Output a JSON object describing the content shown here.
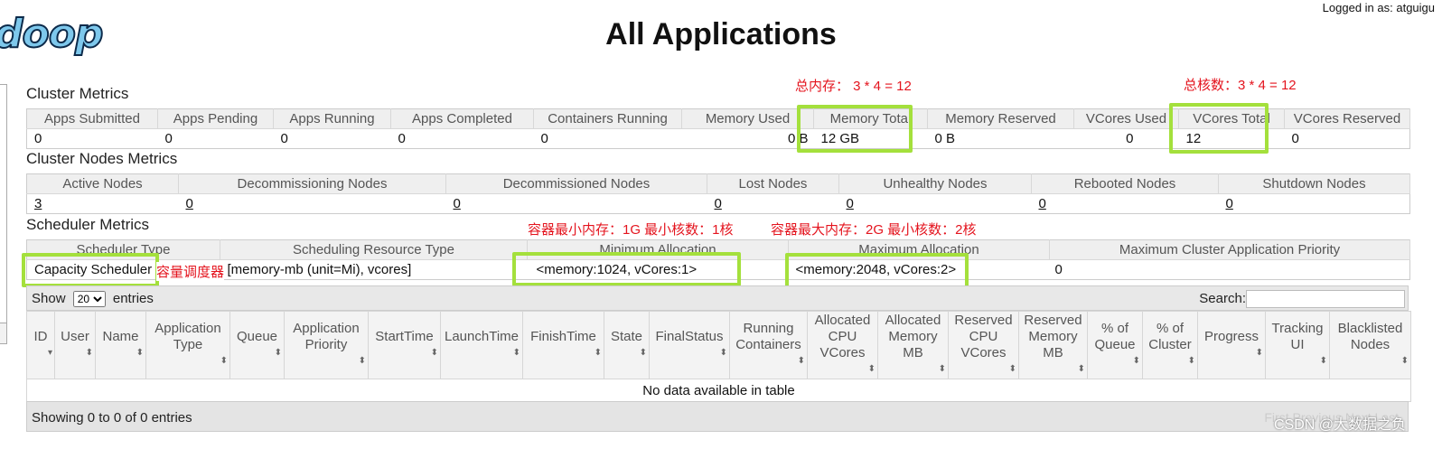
{
  "header": {
    "logo_text": "doop",
    "title": "All Applications",
    "logged_in": "Logged in as: atguigu"
  },
  "cluster_metrics": {
    "title": "Cluster Metrics",
    "headers": [
      "Apps Submitted",
      "Apps Pending",
      "Apps Running",
      "Apps Completed",
      "Containers Running",
      "Memory Used",
      "Memory Total",
      "Memory Reserved",
      "VCores Used",
      "VCores Total",
      "VCores Reserved"
    ],
    "values": [
      "0",
      "0",
      "0",
      "0",
      "0",
      "0 B",
      "12 GB",
      "0 B",
      "0",
      "12",
      "0"
    ]
  },
  "nodes_metrics": {
    "title": "Cluster Nodes Metrics",
    "headers": [
      "Active Nodes",
      "Decommissioning Nodes",
      "Decommissioned Nodes",
      "Lost Nodes",
      "Unhealthy Nodes",
      "Rebooted Nodes",
      "Shutdown Nodes"
    ],
    "values": [
      "3",
      "0",
      "0",
      "0",
      "0",
      "0",
      "0"
    ]
  },
  "scheduler_metrics": {
    "title": "Scheduler Metrics",
    "headers": [
      "Scheduler Type",
      "Scheduling Resource Type",
      "Minimum Allocation",
      "Maximum Allocation",
      "Maximum Cluster Application Priority"
    ],
    "values": [
      "Capacity Scheduler",
      "[memory-mb (unit=Mi), vcores]",
      "<memory:1024, vCores:1>",
      "<memory:2048, vCores:2>",
      "0"
    ]
  },
  "annotations": {
    "memory_total": "总内存：  3 * 4 = 12",
    "vcores_total": "总核数：3 * 4 = 12",
    "min_alloc": "容器最小内存：1G 最小核数：1核",
    "max_alloc": "容器最大内存：2G 最小核数：2核",
    "scheduler": "容量调度器"
  },
  "apps_table": {
    "show_label": "Show",
    "entries_label": "entries",
    "page_size": "20",
    "search_label": "Search:",
    "columns": [
      "ID",
      "User",
      "Name",
      "Application Type",
      "Queue",
      "Application Priority",
      "StartTime",
      "LaunchTime",
      "FinishTime",
      "State",
      "FinalStatus",
      "Running Containers",
      "Allocated CPU VCores",
      "Allocated Memory MB",
      "Reserved CPU VCores",
      "Reserved Memory MB",
      "% of Queue",
      "% of Cluster",
      "Progress",
      "Tracking UI",
      "Blacklisted Nodes"
    ],
    "empty_message": "No data available in table",
    "info": "Showing 0 to 0 of 0 entries",
    "pagination": [
      "First",
      "Previous",
      "Next",
      "Last"
    ]
  },
  "watermark": "CSDN @大数据之负"
}
